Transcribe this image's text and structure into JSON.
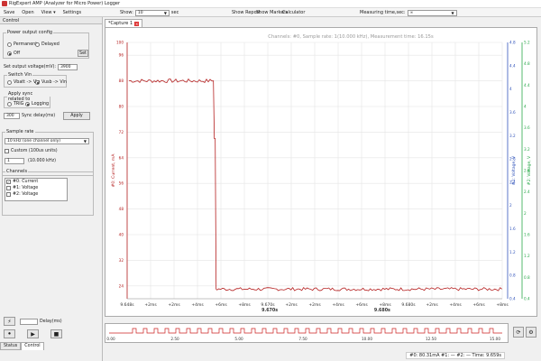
{
  "window": {
    "title": "RigExpert AMP (Analyzer for Micro Power) Logger"
  },
  "menu": {
    "items": [
      "Save",
      "Open",
      "View ▾",
      "Settings"
    ]
  },
  "toolbar": {
    "show_label": "Show:",
    "show_value": "10",
    "show_unit": "sec",
    "show_report": "Show Report",
    "show_markers": "Show Markers",
    "calculator": "Calculator",
    "measuring_time_label": "Measuring time,sec:",
    "measuring_time_value": "∞"
  },
  "left_panel": {
    "tab_label": "Control",
    "power_output": {
      "legend": "Power output config",
      "permanent": "Permanent",
      "delayed": "Delayed",
      "off": "Off",
      "set_button": "Set"
    },
    "voltage": {
      "label": "Set output voltage(mV):",
      "value": "3900"
    },
    "switch_vin": {
      "legend": "Switch Vin",
      "vbatt": "Vbatt -> Vin",
      "vusb": "Vusb -> Vin"
    },
    "apply_sync": {
      "legend": "Apply sync related to",
      "trig": "TRIG",
      "logging": "Logging",
      "delay_value": "300",
      "delay_label": "Sync delay(ms)",
      "apply_button": "Apply"
    },
    "sample_rate": {
      "legend": "Sample rate",
      "value": "10 kHz (one channel only)",
      "custom_label": "Custom (100us units)",
      "custom_value": "1",
      "custom_readout": "(10.000 kHz)"
    },
    "channels": {
      "legend": "Channels",
      "items": [
        {
          "label": "#0: Current",
          "checked": true
        },
        {
          "label": "#1: Voltage",
          "checked": false
        },
        {
          "label": "#2: Voltage",
          "checked": false
        }
      ]
    },
    "delay_label": "Delay(ms)",
    "bottom_tabs": [
      "Status",
      "Control"
    ]
  },
  "plot": {
    "tab_label": "*Capture 1",
    "header": "Channels: #0,  Sample rate: 1(10.000 kHz), Measurement time: 16.15s",
    "status": "#0: 80.31mA  #1: —  #2: —  Time: 9.659s"
  },
  "chart_data": {
    "type": "line",
    "title": "Channels: #0,  Sample rate: 1(10.000 kHz), Measurement time: 16.15s",
    "y_left": {
      "label": "#0: Current, mA",
      "range": [
        20,
        100
      ],
      "ticks": [
        "100",
        "96",
        "88",
        "80",
        "72",
        "64",
        "56",
        "48",
        "40",
        "32",
        "24"
      ]
    },
    "y_mid": {
      "label": "#1: Voltage, V",
      "ticks": [
        "4.8",
        "4.4",
        "4",
        "3.6",
        "3.2",
        "2.8",
        "2.4",
        "2",
        "1.6",
        "1.2",
        "0.8",
        "0.4"
      ]
    },
    "y_right": {
      "label": "#2: Voltage, V",
      "ticks": [
        "5.2",
        "4.8",
        "4.4",
        "4",
        "3.6",
        "3.2",
        "2.8",
        "2.4",
        "2",
        "1.6",
        "1.2",
        "0.8",
        "0.4"
      ]
    },
    "x": {
      "ticks": [
        "9.648s",
        "+2ms",
        "+2ms",
        "+4ms",
        "+6ms",
        "+8ms",
        "9.670s",
        "+2ms",
        "+2ms",
        "+4ms",
        "+6ms",
        "+8ms",
        "9.680s",
        "+2ms",
        "+4ms",
        "+6ms",
        "+8ms"
      ],
      "centre_labels": [
        "9.670s",
        "9.680s"
      ]
    },
    "series": [
      {
        "name": "#0: Current",
        "color": "#b52020",
        "high_level": 88,
        "low_level": 23,
        "drop_fraction": 0.23
      }
    ],
    "grid": true
  },
  "timeline": {
    "ticks": [
      "0.00",
      "2.50",
      "5.00",
      "7.50",
      "10.00",
      "12.50",
      "15.00"
    ]
  }
}
